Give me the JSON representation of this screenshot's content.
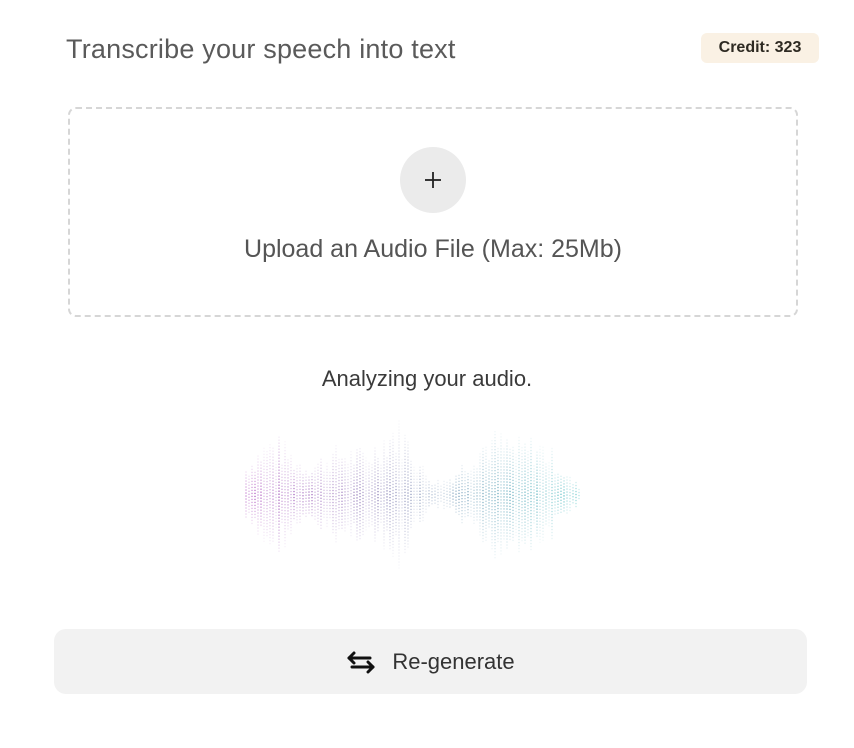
{
  "header": {
    "title": "Transcribe your speech into text",
    "credit_label": "Credit: 323"
  },
  "upload": {
    "plus_symbol": "+",
    "label": "Upload an Audio File (Max: 25Mb)"
  },
  "analysis": {
    "status_text": "Analyzing your audio."
  },
  "waveform": {
    "colors": {
      "start": "#b04fbf",
      "middle": "#8a94b8",
      "end": "#4fc2c4"
    }
  },
  "actions": {
    "regenerate_label": "Re-generate",
    "regenerate_icon": "swap-arrows-icon"
  },
  "theme": {
    "credit_bg": "#faf1e4",
    "button_bg": "#f2f2f2",
    "circle_bg": "#ebebeb"
  }
}
